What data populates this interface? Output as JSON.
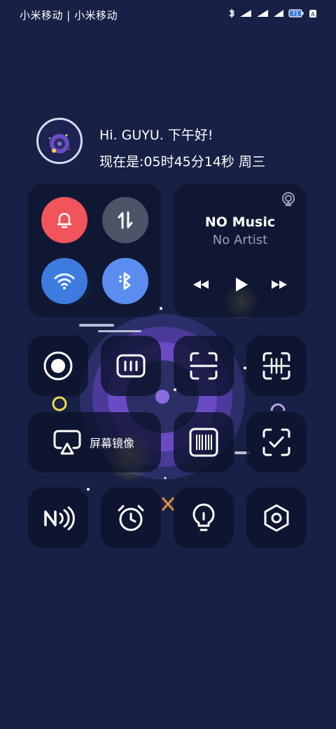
{
  "status_bar": {
    "carrier": "小米移动 | 小米移动",
    "icons": [
      "bluetooth-icon",
      "signal-icon",
      "signal-icon",
      "wifi-icon",
      "battery-icon",
      "alarm-icon"
    ],
    "battery_level": "71"
  },
  "header": {
    "greeting": "Hi. GUYU. 下午好!",
    "time_line": "现在是:05时45分14秒 周三"
  },
  "toggles": [
    {
      "name": "notification-bell",
      "icon": "bell-icon",
      "color": "#f2545b"
    },
    {
      "name": "mobile-data",
      "icon": "data-arrows-icon",
      "color": "#4d5468"
    },
    {
      "name": "wifi",
      "icon": "wifi-icon",
      "color": "#3d7be0"
    },
    {
      "name": "bluetooth",
      "icon": "bluetooth-icon",
      "color": "#5b8df0"
    }
  ],
  "music": {
    "title": "NO Music",
    "artist": "No Artist",
    "controls": [
      "previous-icon",
      "play-icon",
      "next-icon"
    ]
  },
  "shortcuts_row1": [
    "screen-record",
    "vibrate",
    "screenshot-crop",
    "scan"
  ],
  "shortcuts_row2": {
    "screen_mirror_label": "屏幕镜像",
    "items": [
      "barcode",
      "checkbox-scan"
    ]
  },
  "shortcuts_row3": [
    "nfc",
    "alarm-clock",
    "flashlight",
    "settings-hexagon"
  ],
  "colors": {
    "background": "#172045",
    "tile": "#0c122a",
    "accent_red": "#f2545b",
    "accent_blue": "#3d7be0",
    "accent_yellow": "#f2d84a",
    "accent_purple": "#6a4bc4"
  }
}
